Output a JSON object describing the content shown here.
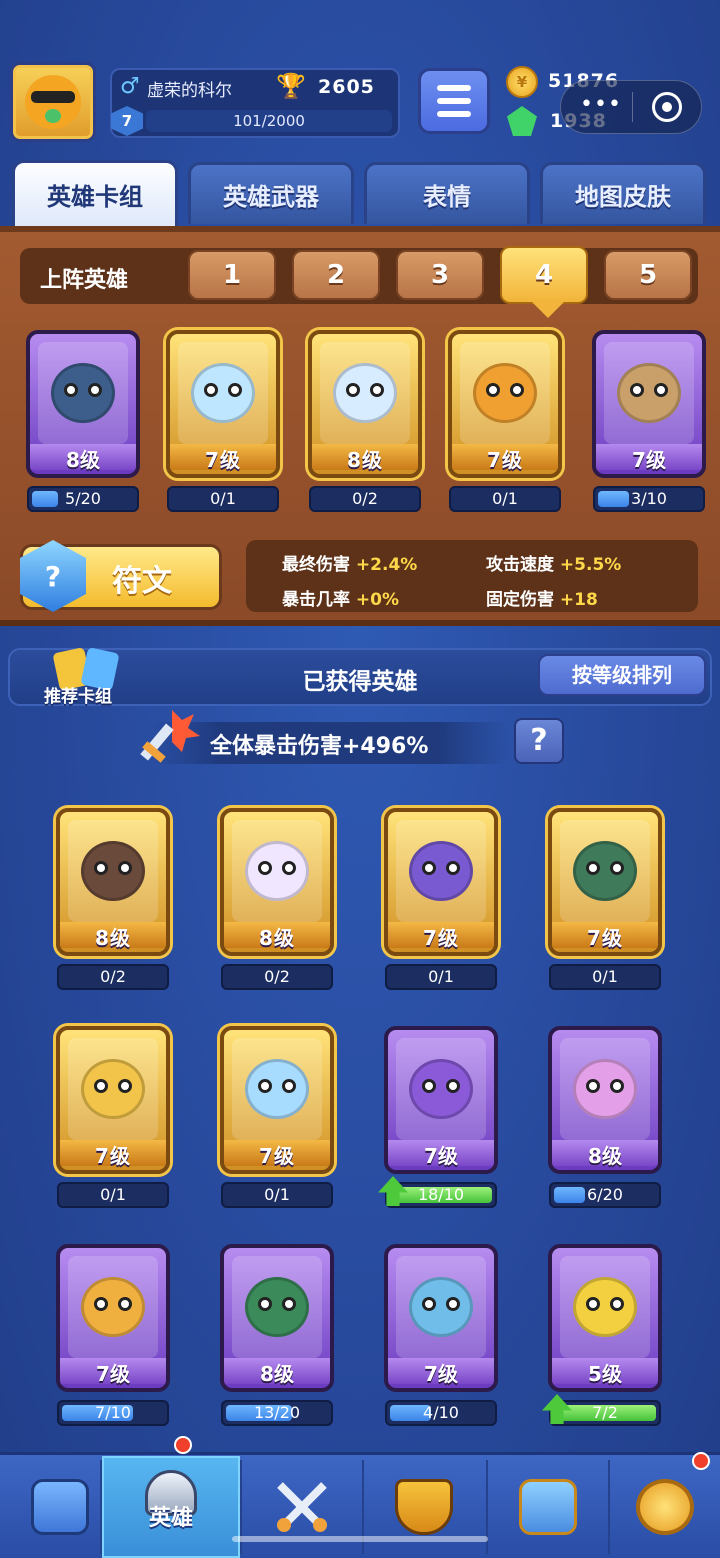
{
  "player": {
    "name": "虚荣的科尔",
    "gender_symbol": "♂",
    "trophies": "2605",
    "level": "7",
    "xp": "101/2000"
  },
  "currency": {
    "gold": "51876",
    "gold_symbol": "¥",
    "gems": "1938"
  },
  "miniapp": {
    "more": "•••"
  },
  "tabs": [
    {
      "label": "英雄卡组",
      "active": true
    },
    {
      "label": "英雄武器"
    },
    {
      "label": "表情"
    },
    {
      "label": "地图皮肤"
    }
  ],
  "lineup": {
    "label": "上阵英雄",
    "slots": [
      "1",
      "2",
      "3",
      "4",
      "5"
    ],
    "active_slot": 4
  },
  "lineup_heroes": [
    {
      "level": "8级",
      "progress": "5/20",
      "rarity": "purple",
      "fill": 0.25,
      "color": "#3d5d8a"
    },
    {
      "level": "7级",
      "progress": "0/1",
      "rarity": "gold",
      "fill": 0,
      "color": "#bfe6ff"
    },
    {
      "level": "8级",
      "progress": "0/2",
      "rarity": "gold",
      "fill": 0,
      "color": "#d8ecff"
    },
    {
      "level": "7级",
      "progress": "0/1",
      "rarity": "gold",
      "fill": 0,
      "color": "#f0a030"
    },
    {
      "level": "7级",
      "progress": "3/10",
      "rarity": "purple",
      "fill": 0.3,
      "color": "#c9a06a"
    }
  ],
  "rune": {
    "label": "符文",
    "stats": [
      {
        "name": "最终伤害",
        "value": "+2.4%"
      },
      {
        "name": "攻击速度",
        "value": "+5.5%"
      },
      {
        "name": "暴击几率",
        "value": "+0%"
      },
      {
        "name": "固定伤害",
        "value": "+18"
      }
    ]
  },
  "owned": {
    "recommended_label": "推荐卡组",
    "title": "已获得英雄",
    "sort_label": "按等级排列",
    "crit_text": "全体暴击伤害+496%",
    "help": "?"
  },
  "owned_heroes": [
    {
      "level": "8级",
      "progress": "0/2",
      "rarity": "gold",
      "fill": 0,
      "color": "#6a4a3a"
    },
    {
      "level": "8级",
      "progress": "0/2",
      "rarity": "gold",
      "fill": 0,
      "color": "#f0e6ff"
    },
    {
      "level": "7级",
      "progress": "0/1",
      "rarity": "gold",
      "fill": 0,
      "color": "#7a5ad0"
    },
    {
      "level": "7级",
      "progress": "0/1",
      "rarity": "gold",
      "fill": 0,
      "color": "#3f7a5a"
    },
    {
      "level": "7级",
      "progress": "0/1",
      "rarity": "gold",
      "fill": 0,
      "color": "#f2c44a"
    },
    {
      "level": "7级",
      "progress": "0/1",
      "rarity": "gold",
      "fill": 0,
      "color": "#a8dcff"
    },
    {
      "level": "7级",
      "progress": "18/10",
      "rarity": "purple",
      "fill": 1,
      "upgrade": true,
      "color": "#8a5ad8"
    },
    {
      "level": "8级",
      "progress": "6/20",
      "rarity": "purple",
      "fill": 0.3,
      "color": "#e3a0e8"
    },
    {
      "level": "7级",
      "progress": "7/10",
      "rarity": "purple",
      "fill": 0.7,
      "color": "#f0b040"
    },
    {
      "level": "8级",
      "progress": "13/20",
      "rarity": "purple",
      "fill": 0.65,
      "color": "#3a8a5a"
    },
    {
      "level": "7级",
      "progress": "4/10",
      "rarity": "purple",
      "fill": 0.4,
      "color": "#6fbde8"
    },
    {
      "level": "5级",
      "progress": "7/2",
      "rarity": "purple",
      "fill": 1,
      "upgrade": true,
      "color": "#f2d040"
    }
  ],
  "nav": {
    "active_label": "英雄",
    "items": [
      "treasure-chest",
      "hero-helmet",
      "crossed-swords",
      "crown-shield",
      "team-banner",
      "compass"
    ]
  }
}
